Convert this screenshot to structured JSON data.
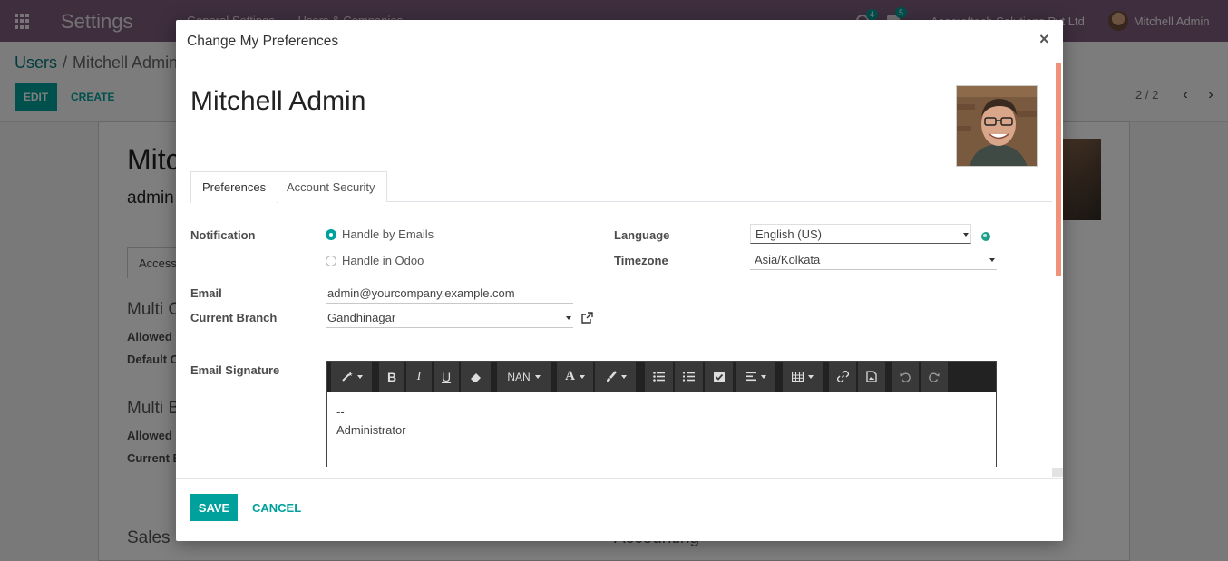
{
  "app": {
    "title": "Settings",
    "menu": [
      "General Settings",
      "Users & Companies"
    ],
    "activity_count": "4",
    "message_count": "5",
    "company": "Acecraftech Solutions Pvt Ltd",
    "user_name": "Mitchell Admin"
  },
  "breadcrumb": {
    "root": "Users",
    "separator": "/",
    "current": "Mitchell Admin"
  },
  "actions": {
    "edit": "EDIT",
    "create": "CREATE"
  },
  "pager": {
    "value": "2 / 2"
  },
  "background_form": {
    "name": "Mitc",
    "login": "admin",
    "tab": "Access",
    "sections": [
      "Multi C",
      "Multi B",
      "Sales",
      "Accounting"
    ],
    "fields": [
      "Allowed C",
      "Default C",
      "Allowed B",
      "Current B"
    ]
  },
  "dialog": {
    "title": "Change My Preferences",
    "close_symbol": "×",
    "record_name": "Mitchell Admin",
    "tabs": [
      {
        "label": "Preferences",
        "active": true
      },
      {
        "label": "Account Security",
        "active": false
      }
    ],
    "notification": {
      "label": "Notification",
      "options": [
        {
          "label": "Handle by Emails",
          "checked": true
        },
        {
          "label": "Handle in Odoo",
          "checked": false
        }
      ]
    },
    "language": {
      "label": "Language",
      "value": "English (US)"
    },
    "timezone": {
      "label": "Timezone",
      "value": "Asia/Kolkata"
    },
    "email": {
      "label": "Email",
      "value": "admin@yourcompany.example.com"
    },
    "branch": {
      "label": "Current Branch",
      "value": "Gandhinagar"
    },
    "signature": {
      "label": "Email Signature",
      "font_size_label": "NAN",
      "lines": [
        "--",
        "Administrator"
      ]
    },
    "buttons": {
      "save": "SAVE",
      "cancel": "CANCEL"
    }
  },
  "colors": {
    "navbar": "#7c5c7c",
    "primary": "#00a09d",
    "scrollbar": "#f0927a",
    "toolbar": "#222222"
  },
  "icons": {
    "toolbar": [
      "magic-wand-icon",
      "bold-icon",
      "italic-icon",
      "underline-icon",
      "eraser-icon",
      "font-color-icon",
      "paint-brush-icon",
      "bullet-list-icon",
      "numbered-list-icon",
      "checklist-icon",
      "align-icon",
      "table-icon",
      "link-icon",
      "image-icon",
      "undo-icon",
      "redo-icon"
    ]
  }
}
